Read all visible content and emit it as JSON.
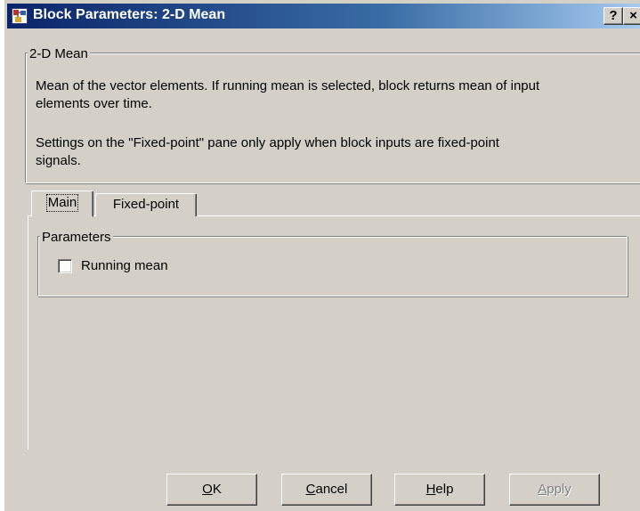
{
  "window": {
    "title": "Block Parameters: 2-D Mean",
    "help_button": "?",
    "close_button": "×"
  },
  "description": {
    "group_label": "2-D Mean",
    "line1": "Mean of the vector elements.  If running mean is selected, block returns mean of input",
    "line2": "elements over time.",
    "line3": "Settings on the \"Fixed-point\" pane only apply when block inputs are fixed-point",
    "line4": "signals."
  },
  "tabs": [
    {
      "label": "Main",
      "selected": true
    },
    {
      "label": "Fixed-point",
      "selected": false
    }
  ],
  "parameters": {
    "group_label": "Parameters",
    "running_mean": {
      "label": "Running mean",
      "checked": false
    }
  },
  "buttons": {
    "ok": {
      "mnemonic": "O",
      "rest": "K"
    },
    "cancel": {
      "mnemonic": "C",
      "rest": "ancel"
    },
    "help": {
      "mnemonic": "H",
      "rest": "elp"
    },
    "apply": {
      "mnemonic": "A",
      "rest": "pply",
      "enabled": false
    }
  },
  "colors": {
    "titlebar_start": "#0a246a",
    "titlebar_end": "#a6caf0",
    "face": "#d4d0c8"
  }
}
